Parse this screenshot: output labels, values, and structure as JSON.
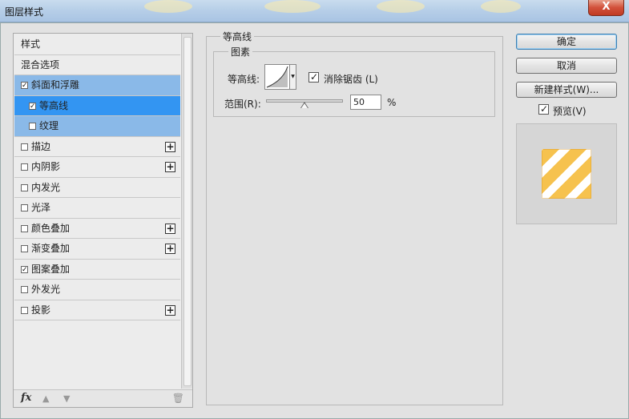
{
  "window": {
    "title": "图层样式",
    "close_label": "X"
  },
  "styles_list": {
    "items": [
      {
        "label": "样式",
        "checkbox": false,
        "checked": false,
        "plus": false,
        "state": "normal",
        "indent": false
      },
      {
        "label": "混合选项",
        "checkbox": false,
        "checked": false,
        "plus": false,
        "state": "normal",
        "indent": false
      },
      {
        "label": "斜面和浮雕",
        "checkbox": true,
        "checked": true,
        "plus": false,
        "state": "selected",
        "indent": false
      },
      {
        "label": "等高线",
        "checkbox": true,
        "checked": true,
        "plus": false,
        "state": "active",
        "indent": true
      },
      {
        "label": "纹理",
        "checkbox": true,
        "checked": false,
        "plus": false,
        "state": "selected",
        "indent": true
      },
      {
        "label": "描边",
        "checkbox": true,
        "checked": false,
        "plus": true,
        "state": "normal",
        "indent": false
      },
      {
        "label": "内阴影",
        "checkbox": true,
        "checked": false,
        "plus": true,
        "state": "normal",
        "indent": false
      },
      {
        "label": "内发光",
        "checkbox": true,
        "checked": false,
        "plus": false,
        "state": "normal",
        "indent": false
      },
      {
        "label": "光泽",
        "checkbox": true,
        "checked": false,
        "plus": false,
        "state": "normal",
        "indent": false
      },
      {
        "label": "颜色叠加",
        "checkbox": true,
        "checked": false,
        "plus": true,
        "state": "normal",
        "indent": false
      },
      {
        "label": "渐变叠加",
        "checkbox": true,
        "checked": false,
        "plus": true,
        "state": "normal",
        "indent": false
      },
      {
        "label": "图案叠加",
        "checkbox": true,
        "checked": true,
        "plus": false,
        "state": "normal",
        "indent": false
      },
      {
        "label": "外发光",
        "checkbox": true,
        "checked": false,
        "plus": false,
        "state": "normal",
        "indent": false
      },
      {
        "label": "投影",
        "checkbox": true,
        "checked": false,
        "plus": true,
        "state": "normal",
        "indent": false
      }
    ],
    "footer": {
      "fx_label": "fx"
    }
  },
  "contour_panel": {
    "group_title": "等高线",
    "subgroup_title": "图素",
    "contour_label": "等高线:",
    "antialias_label": "消除锯齿 (L)",
    "antialias_checked": true,
    "range_label": "范围(R):",
    "range_value": "50",
    "range_percent": 0.5,
    "range_unit": "%"
  },
  "buttons": {
    "ok": "确定",
    "cancel": "取消",
    "new_style": "新建样式(W)...",
    "preview_label": "预览(V)",
    "preview_checked": true
  },
  "colors": {
    "selected_row": "#8ab9e8",
    "active_row": "#3395f2",
    "pattern_orange": "#f6c24e"
  },
  "icons": [
    "close-icon",
    "checkbox-icon",
    "plus-icon",
    "fx-icon",
    "arrow-up-icon",
    "arrow-down-icon",
    "trash-icon",
    "chevron-down-icon",
    "slider-thumb-icon"
  ]
}
